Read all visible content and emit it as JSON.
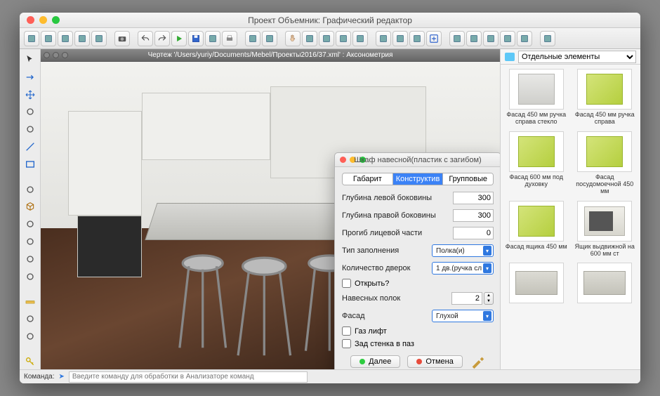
{
  "window": {
    "title": "Проект Объемник: Графический редактор"
  },
  "toolbar_icons": [
    "cube-blue",
    "cube-cyan",
    "cube-orange",
    "cube-teal",
    "cube-magenta",
    "sep",
    "camera",
    "sep",
    "undo",
    "redo",
    "play",
    "disk",
    "save",
    "print",
    "sep",
    "rotate-ccw",
    "rotate-cw",
    "sep",
    "hand",
    "move",
    "align",
    "grid",
    "snap",
    "sep",
    "layers",
    "3d-box",
    "3d-cube",
    "plus-box",
    "sep",
    "grid-blue",
    "grid2",
    "tree",
    "swap",
    "swap2",
    "sep",
    "save2"
  ],
  "left_tools": [
    "pointer",
    "arrow",
    "move",
    "curve",
    "house",
    "line",
    "rect",
    "sep",
    "dash",
    "cube",
    "stairs",
    "pipe",
    "spline",
    "merge",
    "sep",
    "ruler",
    "dim",
    "frame",
    "sep",
    "key"
  ],
  "viewport": {
    "tab_label": "Чертеж '/Users/yuriy/Documents/Mebel/Проекты2016/37.xml' : Аксонометрия"
  },
  "dialog": {
    "title": "Шкаф навесной(пластик с загибом)",
    "tabs": [
      "Габарит",
      "Конструктив",
      "Групповые"
    ],
    "active_tab": 1,
    "rows": {
      "left_depth_label": "Глубина левой боковины",
      "left_depth": "300",
      "right_depth_label": "Глубина правой боковины",
      "right_depth": "300",
      "bend_label": "Прогиб лицевой части",
      "bend": "0",
      "fill_label": "Тип заполнения",
      "fill": "Полка(и)",
      "doors_label": "Количество дверок",
      "doors": "1 дв.(ручка сл",
      "open_label": "Открыть?",
      "shelves_label": "Навесных полок",
      "shelves": "2",
      "facade_label": "Фасад",
      "facade": "Глухой",
      "gas_label": "Газ лифт",
      "backwall_label": "Зад стенка в паз"
    },
    "buttons": {
      "next": "Далее",
      "cancel": "Отмена"
    }
  },
  "catalog": {
    "header": "Отдельные элементы",
    "items": [
      {
        "label": "Фасад 450 мм ручка справа стекло",
        "style": "grey"
      },
      {
        "label": "Фасад 450 мм ручка справа",
        "style": "green"
      },
      {
        "label": "Фасад 600 мм под духовку",
        "style": "green"
      },
      {
        "label": "Фасад посудомоечной 450 мм",
        "style": "green"
      },
      {
        "label": "Фасад ящика 450 мм",
        "style": "green"
      },
      {
        "label": "Ящик выдвижной на 600 мм ст",
        "style": "box"
      },
      {
        "label": "",
        "style": "drawer"
      },
      {
        "label": "",
        "style": "drawer"
      }
    ]
  },
  "status": {
    "label": "Команда:",
    "placeholder": "Введите команду для обработки в Анализаторе команд"
  }
}
